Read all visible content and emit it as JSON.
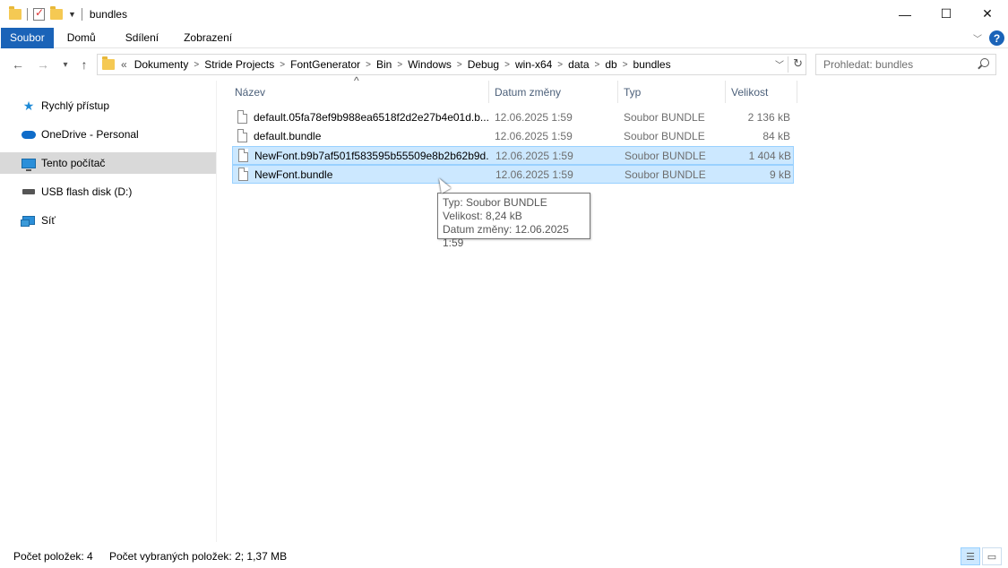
{
  "window": {
    "title": "bundles",
    "minimize": "—",
    "maximize": "☐",
    "close": "✕"
  },
  "ribbon": {
    "tabs": [
      "Soubor",
      "Domů",
      "Sdílení",
      "Zobrazení"
    ],
    "help": "?"
  },
  "nav": {
    "back": "←",
    "forward": "→",
    "recent": "▾",
    "up": "↑"
  },
  "address": {
    "overflow": "«",
    "crumbs": [
      "Dokumenty",
      "Stride Projects",
      "FontGenerator",
      "Bin",
      "Windows",
      "Debug",
      "win-x64",
      "data",
      "db",
      "bundles"
    ]
  },
  "search": {
    "placeholder": "Prohledat: bundles"
  },
  "sidebar": {
    "items": [
      {
        "label": "Rychlý přístup",
        "icon": "quick-access-star-icon"
      },
      {
        "label": "OneDrive - Personal",
        "icon": "onedrive-cloud-icon"
      },
      {
        "label": "Tento počítač",
        "icon": "this-pc-icon"
      },
      {
        "label": "USB flash disk (D:)",
        "icon": "usb-drive-icon"
      },
      {
        "label": "Síť",
        "icon": "network-icon"
      }
    ],
    "active_index": 2
  },
  "columns": {
    "name": "Název",
    "date": "Datum změny",
    "type": "Typ",
    "size": "Velikost"
  },
  "files": [
    {
      "name": "default.05fa78ef9b988ea6518f2d2e27b4e01d.b...",
      "date": "12.06.2025 1:59",
      "type": "Soubor BUNDLE",
      "size": "2 136 kB",
      "selected": false
    },
    {
      "name": "default.bundle",
      "date": "12.06.2025 1:59",
      "type": "Soubor BUNDLE",
      "size": "84 kB",
      "selected": false
    },
    {
      "name": "NewFont.b9b7af501f583595b55509e8b2b62b9d...",
      "date": "12.06.2025 1:59",
      "type": "Soubor BUNDLE",
      "size": "1 404 kB",
      "selected": true
    },
    {
      "name": "NewFont.bundle",
      "date": "12.06.2025 1:59",
      "type": "Soubor BUNDLE",
      "size": "9 kB",
      "selected": true
    }
  ],
  "tooltip": {
    "type": "Typ: Soubor BUNDLE",
    "size": "Velikost: 8,24 kB",
    "date": "Datum změny: 12.06.2025 1:59"
  },
  "status": {
    "count": "Počet položek: 4",
    "selected": "Počet vybraných položek: 2; 1,37 MB"
  },
  "colors": {
    "accent": "#1a63b8",
    "selection": "#cce8ff",
    "selection_border": "#99d1ff",
    "active_nav": "#d9d9d9"
  }
}
